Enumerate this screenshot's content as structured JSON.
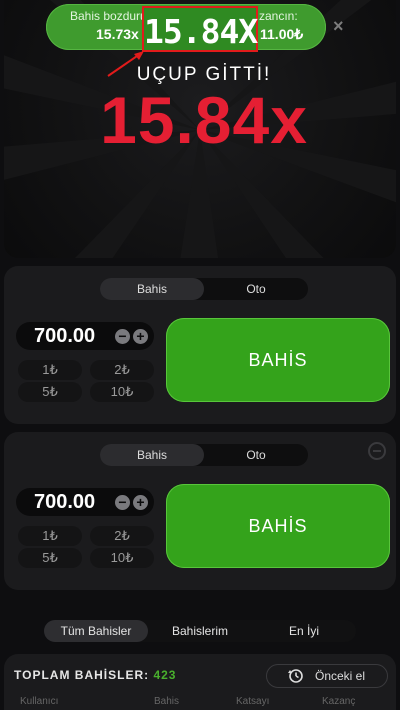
{
  "toast": {
    "bet_label": "Bahis bozdurul",
    "bet_value": "15.73x",
    "win_label": "zancın:",
    "win_value": "11.00₺",
    "close": "×",
    "highlight": "15.84X"
  },
  "game": {
    "status": "UÇUP GİTTİ!",
    "multiplier": "15.84x"
  },
  "bet_panels": [
    {
      "tabs": [
        "Bahis",
        "Oto"
      ],
      "amount": "700.00",
      "minus": "−",
      "plus": "+",
      "chips": [
        "1₺",
        "2₺",
        "5₺",
        "10₺"
      ],
      "button": "BAHİS"
    },
    {
      "tabs": [
        "Bahis",
        "Oto"
      ],
      "amount": "700.00",
      "minus": "−",
      "plus": "+",
      "chips": [
        "1₺",
        "2₺",
        "5₺",
        "10₺"
      ],
      "button": "BAHİS"
    }
  ],
  "bets_tabs": [
    "Tüm Bahisler",
    "Bahislerim",
    "En İyi"
  ],
  "footer": {
    "total_label": "TOPLAM BAHİSLER:",
    "total_count": "423",
    "prev_button": "Önceki el",
    "columns": [
      "Kullanıcı",
      "Bahis",
      "Katsayı",
      "Kazanç"
    ]
  },
  "colors": {
    "accent_green": "#34a31b",
    "multiplier_red": "#e51f33",
    "highlight_box": "#e21b1b"
  },
  "icons": [
    "close-icon",
    "arrow-icon",
    "minus-icon",
    "plus-icon",
    "history-icon"
  ]
}
